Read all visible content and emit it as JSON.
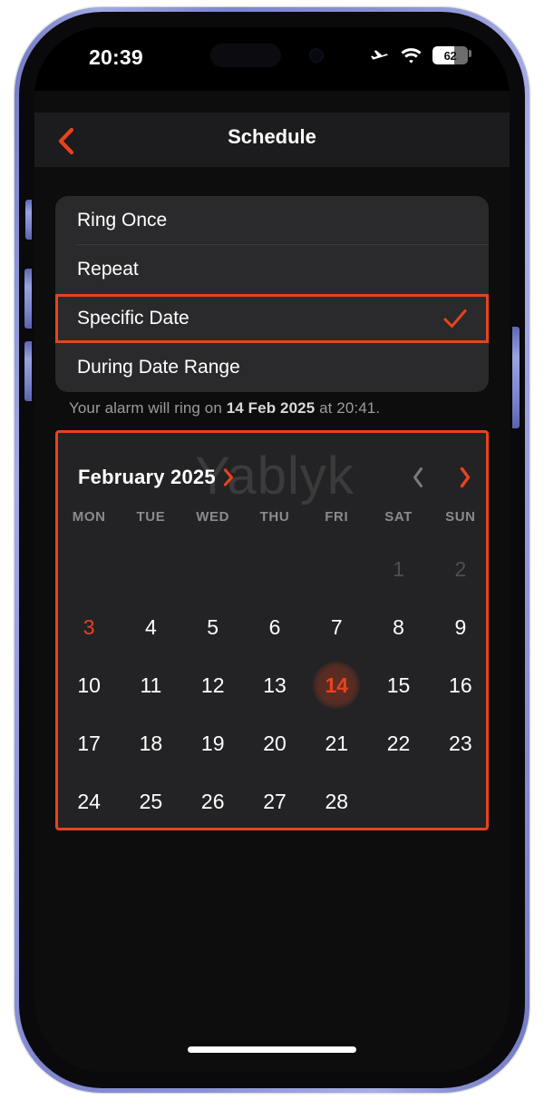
{
  "status_bar": {
    "time": "20:39",
    "airplane_icon": "airplane-mode-icon",
    "wifi_icon": "wifi-icon",
    "battery_percent": "62",
    "battery_fill_pct": 62
  },
  "nav": {
    "back_icon": "chevron-left-icon",
    "title": "Schedule"
  },
  "options": {
    "items": [
      {
        "label": "Ring Once",
        "selected": false
      },
      {
        "label": "Repeat",
        "selected": false
      },
      {
        "label": "Specific Date",
        "selected": true
      },
      {
        "label": "During Date Range",
        "selected": false
      }
    ],
    "check_icon": "checkmark-icon"
  },
  "note": {
    "prefix": "Your alarm will ring on ",
    "date": "14 Feb 2025",
    "suffix": " at 20:41."
  },
  "calendar": {
    "watermark": "Yablyk",
    "month_label": "February 2025",
    "month_chevron_icon": "chevron-right-icon",
    "prev_icon": "chevron-left-icon",
    "next_icon": "chevron-right-icon",
    "weekdays": [
      "MON",
      "TUE",
      "WED",
      "THU",
      "FRI",
      "SAT",
      "SUN"
    ],
    "leading_blanks": 5,
    "days": [
      {
        "n": "1",
        "state": "muted"
      },
      {
        "n": "2",
        "state": "muted"
      },
      {
        "n": "3",
        "state": "today"
      },
      {
        "n": "4",
        "state": "normal"
      },
      {
        "n": "5",
        "state": "normal"
      },
      {
        "n": "6",
        "state": "normal"
      },
      {
        "n": "7",
        "state": "normal"
      },
      {
        "n": "8",
        "state": "normal"
      },
      {
        "n": "9",
        "state": "normal"
      },
      {
        "n": "10",
        "state": "normal"
      },
      {
        "n": "11",
        "state": "normal"
      },
      {
        "n": "12",
        "state": "normal"
      },
      {
        "n": "13",
        "state": "normal"
      },
      {
        "n": "14",
        "state": "selected"
      },
      {
        "n": "15",
        "state": "normal"
      },
      {
        "n": "16",
        "state": "normal"
      },
      {
        "n": "17",
        "state": "normal"
      },
      {
        "n": "18",
        "state": "normal"
      },
      {
        "n": "19",
        "state": "normal"
      },
      {
        "n": "20",
        "state": "normal"
      },
      {
        "n": "21",
        "state": "normal"
      },
      {
        "n": "22",
        "state": "normal"
      },
      {
        "n": "23",
        "state": "normal"
      },
      {
        "n": "24",
        "state": "normal"
      },
      {
        "n": "25",
        "state": "normal"
      },
      {
        "n": "26",
        "state": "normal"
      },
      {
        "n": "27",
        "state": "normal"
      },
      {
        "n": "28",
        "state": "normal"
      }
    ]
  },
  "colors": {
    "accent": "#e8431d",
    "highlight_box": "#e8431d",
    "card": "#2a2a2c",
    "calendar_bg": "#232325",
    "screen_bg": "#0d0d0d",
    "frame": "#8b93d6"
  },
  "home_indicator": "home-indicator"
}
